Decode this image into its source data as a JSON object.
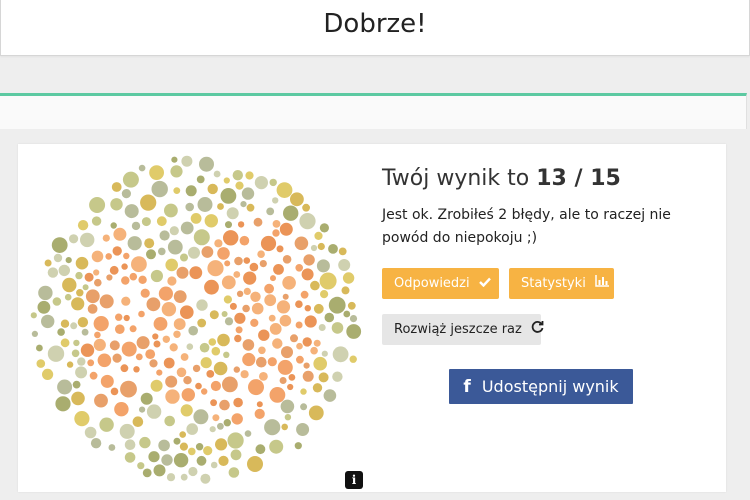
{
  "header": {
    "title": "Dobrze!"
  },
  "result": {
    "headline_prefix": "Twój wynik to",
    "score": "13 / 15",
    "description": "Jest ok. Zrobiłeś 2 błędy, ale to raczej nie powód do niepokoju ;)"
  },
  "buttons": {
    "answers": "Odpowiedzi",
    "stats": "Statystyki",
    "retry": "Rozwiąż jeszcze raz",
    "share": "Udostępnij wynik"
  },
  "icons": {
    "answers": "check-icon",
    "stats": "bar-chart-icon",
    "retry": "refresh-icon",
    "share": "facebook-icon",
    "plate": "info-icon"
  },
  "colors": {
    "accent_green": "#5cc9a1",
    "button_orange": "#f7b343",
    "facebook_blue": "#3b5998",
    "plate_background_dots": [
      "#c6c88a",
      "#a9ad6f",
      "#e0cb6a",
      "#d8b95a",
      "#b8bc9a",
      "#cfd1b0"
    ],
    "plate_figure_dots": [
      "#f3a36a",
      "#eb9457",
      "#f5b27a",
      "#e8a06a"
    ]
  }
}
